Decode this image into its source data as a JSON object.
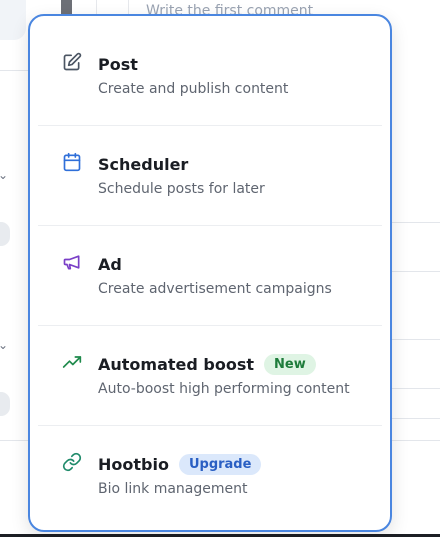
{
  "background": {
    "comment_placeholder": "Write the first comment"
  },
  "menu": {
    "items": [
      {
        "title": "Post",
        "description": "Create and publish content",
        "icon": "edit-icon",
        "badge": ""
      },
      {
        "title": "Scheduler",
        "description": "Schedule posts for later",
        "icon": "calendar-icon",
        "badge": ""
      },
      {
        "title": "Ad",
        "description": "Create advertisement campaigns",
        "icon": "megaphone-icon",
        "badge": ""
      },
      {
        "title": "Automated boost",
        "description": "Auto-boost high performing content",
        "icon": "trending-up-icon",
        "badge": "New"
      },
      {
        "title": "Hootbio",
        "description": "Bio link management",
        "icon": "link-icon",
        "badge": "Upgrade"
      }
    ]
  },
  "colors": {
    "menu_border": "#4a86e0",
    "post_icon": "#4b5563",
    "scheduler_icon": "#2f6fd9",
    "ad_icon": "#7a3fc7",
    "boost_icon": "#1f8a4c",
    "hootbio_icon": "#1f8a6a",
    "badge_new_bg": "#dff4e4",
    "badge_upgrade_bg": "#dbe8fb"
  }
}
